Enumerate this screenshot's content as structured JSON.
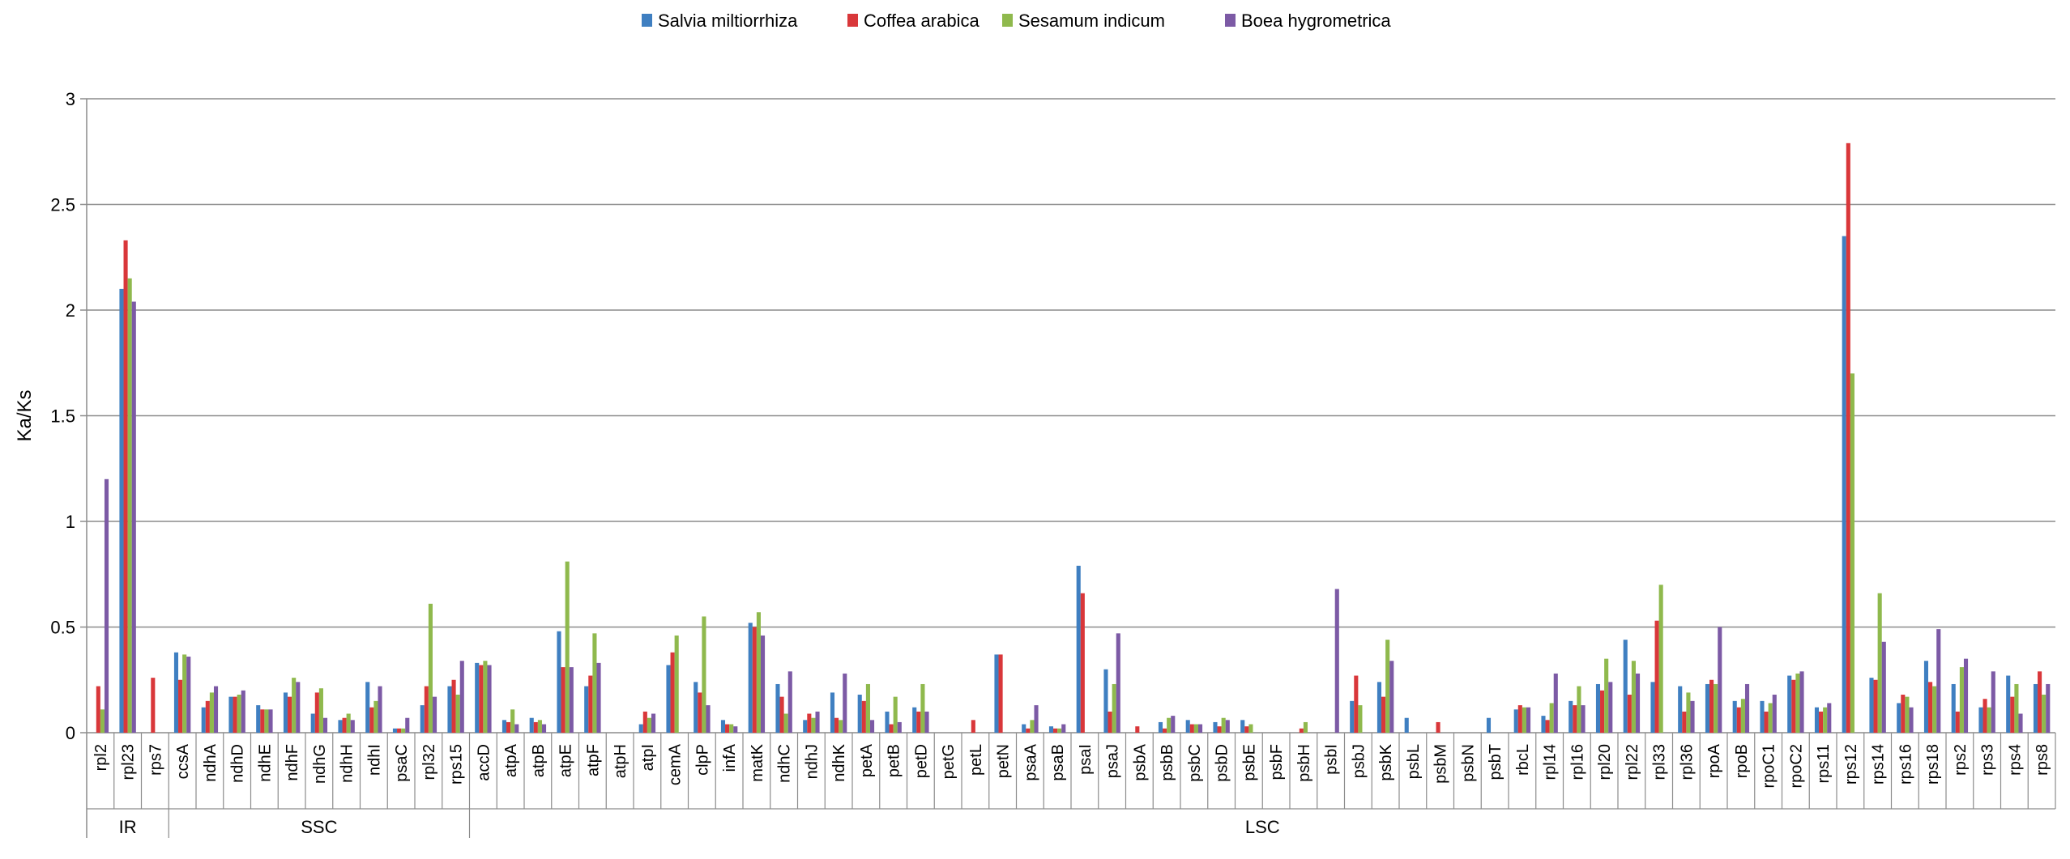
{
  "chart_data": {
    "type": "bar",
    "ylabel": "Ka/Ks",
    "ylim": [
      0,
      3
    ],
    "yticks": [
      "0",
      "0.5",
      "1",
      "1.5",
      "2",
      "2.5",
      "3"
    ],
    "grid": true,
    "legend_position": "top-center",
    "categories": [
      "rpl2",
      "rpl23",
      "rps7",
      "ccsA",
      "ndhA",
      "ndhD",
      "ndhE",
      "ndhF",
      "ndhG",
      "ndhH",
      "ndhI",
      "psaC",
      "rpl32",
      "rps15",
      "accD",
      "atpA",
      "atpB",
      "atpE",
      "atpF",
      "atpH",
      "atpI",
      "cemA",
      "clpP",
      "infA",
      "matK",
      "ndhC",
      "ndhJ",
      "ndhK",
      "petA",
      "petB",
      "petD",
      "petG",
      "petL",
      "petN",
      "psaA",
      "psaB",
      "psaI",
      "psaJ",
      "psbA",
      "psbB",
      "psbC",
      "psbD",
      "psbE",
      "psbF",
      "psbH",
      "psbI",
      "psbJ",
      "psbK",
      "psbL",
      "psbM",
      "psbN",
      "psbT",
      "rbcL",
      "rpl14",
      "rpl16",
      "rpl20",
      "rpl22",
      "rpl33",
      "rpl36",
      "rpoA",
      "rpoB",
      "rpoC1",
      "rpoC2",
      "rps11",
      "rps12",
      "rps14",
      "rps16",
      "rps18",
      "rps2",
      "rps3",
      "rps4",
      "rps8"
    ],
    "groups": [
      {
        "label": "IR",
        "count": 3
      },
      {
        "label": "SSC",
        "count": 11
      },
      {
        "label": "LSC",
        "count": 58
      }
    ],
    "series": [
      {
        "name": "Salvia miltiorrhiza",
        "color": "#3f7fc1",
        "values": [
          0,
          2.1,
          0,
          0.38,
          0.12,
          0.17,
          0.13,
          0.19,
          0.09,
          0.06,
          0.24,
          0.02,
          0.13,
          0.22,
          0.33,
          0.06,
          0.07,
          0.48,
          0.22,
          0,
          0.04,
          0.32,
          0.24,
          0.06,
          0.52,
          0.23,
          0.06,
          0.19,
          0.18,
          0.1,
          0.12,
          0,
          0,
          0.37,
          0.04,
          0.03,
          0.79,
          0.3,
          0,
          0.05,
          0.06,
          0.05,
          0.06,
          0,
          0,
          0,
          0.15,
          0.24,
          0.07,
          0,
          0,
          0.07,
          0.11,
          0.08,
          0.15,
          0.23,
          0.44,
          0.24,
          0.22,
          0.23,
          0.15,
          0.15,
          0.27,
          0.12,
          2.35,
          0.26,
          0.14,
          0.34,
          0.23,
          0.12,
          0.27,
          0.23
        ]
      },
      {
        "name": "Coffea arabica",
        "color": "#d9373a",
        "values": [
          0.22,
          2.33,
          0.26,
          0.25,
          0.15,
          0.17,
          0.11,
          0.17,
          0.19,
          0.07,
          0.12,
          0.02,
          0.22,
          0.25,
          0.32,
          0.05,
          0.05,
          0.31,
          0.27,
          0,
          0.1,
          0.38,
          0.19,
          0.04,
          0.5,
          0.17,
          0.09,
          0.07,
          0.15,
          0.04,
          0.1,
          0,
          0.06,
          0.37,
          0.02,
          0.02,
          0.66,
          0.1,
          0.03,
          0.02,
          0.04,
          0.03,
          0.03,
          0,
          0.02,
          0,
          0.27,
          0.17,
          0,
          0.05,
          0,
          0,
          0.13,
          0.06,
          0.13,
          0.2,
          0.18,
          0.53,
          0.1,
          0.25,
          0.12,
          0.1,
          0.25,
          0.1,
          2.79,
          0.25,
          0.18,
          0.24,
          0.1,
          0.16,
          0.17,
          0.29
        ]
      },
      {
        "name": "Sesamum indicum",
        "color": "#8fb94d",
        "values": [
          0.11,
          2.15,
          0,
          0.37,
          0.19,
          0.18,
          0.11,
          0.26,
          0.21,
          0.09,
          0.15,
          0.02,
          0.61,
          0.18,
          0.34,
          0.11,
          0.06,
          0.81,
          0.47,
          0,
          0.07,
          0.46,
          0.55,
          0.04,
          0.57,
          0.09,
          0.07,
          0.06,
          0.23,
          0.17,
          0.23,
          0,
          0,
          0,
          0.06,
          0.02,
          0,
          0.23,
          0,
          0.07,
          0.04,
          0.07,
          0.04,
          0,
          0.05,
          0,
          0.13,
          0.44,
          0,
          0,
          0,
          0,
          0.12,
          0.14,
          0.22,
          0.35,
          0.34,
          0.7,
          0.19,
          0.23,
          0.16,
          0.14,
          0.28,
          0.12,
          1.7,
          0.66,
          0.17,
          0.22,
          0.31,
          0.12,
          0.23,
          0.18
        ]
      },
      {
        "name": "Boea hygrometrica",
        "color": "#7c5aa5",
        "values": [
          1.2,
          2.04,
          0,
          0.36,
          0.22,
          0.2,
          0.11,
          0.24,
          0.07,
          0.06,
          0.22,
          0.07,
          0.17,
          0.34,
          0.32,
          0.04,
          0.04,
          0.31,
          0.33,
          0,
          0.09,
          0,
          0.13,
          0.03,
          0.46,
          0.29,
          0.1,
          0.28,
          0.06,
          0.05,
          0.1,
          0,
          0,
          0,
          0.13,
          0.04,
          0,
          0.47,
          0,
          0.08,
          0.04,
          0.06,
          0,
          0,
          0,
          0.68,
          0,
          0.34,
          0,
          0,
          0,
          0,
          0.12,
          0.28,
          0.13,
          0.24,
          0.28,
          0,
          0.15,
          0.5,
          0.23,
          0.18,
          0.29,
          0.14,
          0,
          0.43,
          0.12,
          0.49,
          0.35,
          0.29,
          0.09,
          0.23
        ]
      }
    ]
  }
}
